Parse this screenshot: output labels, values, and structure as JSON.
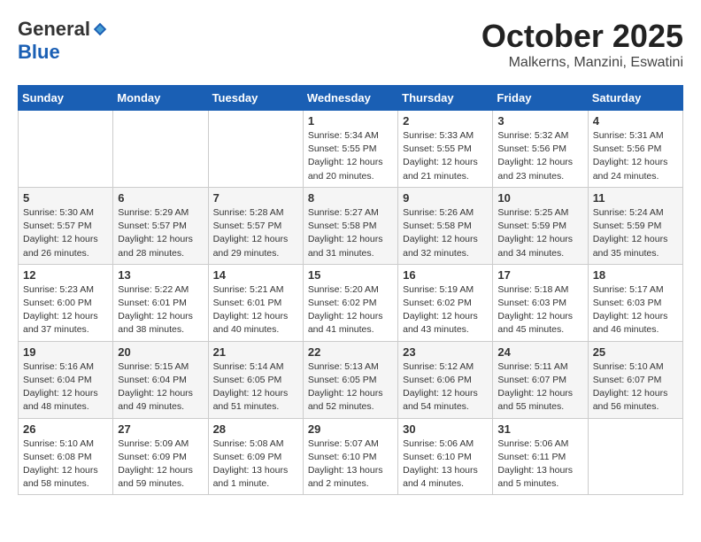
{
  "header": {
    "logo_general": "General",
    "logo_blue": "Blue",
    "month": "October 2025",
    "location": "Malkerns, Manzini, Eswatini"
  },
  "days_of_week": [
    "Sunday",
    "Monday",
    "Tuesday",
    "Wednesday",
    "Thursday",
    "Friday",
    "Saturday"
  ],
  "weeks": [
    [
      {
        "day": "",
        "info": ""
      },
      {
        "day": "",
        "info": ""
      },
      {
        "day": "",
        "info": ""
      },
      {
        "day": "1",
        "info": "Sunrise: 5:34 AM\nSunset: 5:55 PM\nDaylight: 12 hours and 20 minutes."
      },
      {
        "day": "2",
        "info": "Sunrise: 5:33 AM\nSunset: 5:55 PM\nDaylight: 12 hours and 21 minutes."
      },
      {
        "day": "3",
        "info": "Sunrise: 5:32 AM\nSunset: 5:56 PM\nDaylight: 12 hours and 23 minutes."
      },
      {
        "day": "4",
        "info": "Sunrise: 5:31 AM\nSunset: 5:56 PM\nDaylight: 12 hours and 24 minutes."
      }
    ],
    [
      {
        "day": "5",
        "info": "Sunrise: 5:30 AM\nSunset: 5:57 PM\nDaylight: 12 hours and 26 minutes."
      },
      {
        "day": "6",
        "info": "Sunrise: 5:29 AM\nSunset: 5:57 PM\nDaylight: 12 hours and 28 minutes."
      },
      {
        "day": "7",
        "info": "Sunrise: 5:28 AM\nSunset: 5:57 PM\nDaylight: 12 hours and 29 minutes."
      },
      {
        "day": "8",
        "info": "Sunrise: 5:27 AM\nSunset: 5:58 PM\nDaylight: 12 hours and 31 minutes."
      },
      {
        "day": "9",
        "info": "Sunrise: 5:26 AM\nSunset: 5:58 PM\nDaylight: 12 hours and 32 minutes."
      },
      {
        "day": "10",
        "info": "Sunrise: 5:25 AM\nSunset: 5:59 PM\nDaylight: 12 hours and 34 minutes."
      },
      {
        "day": "11",
        "info": "Sunrise: 5:24 AM\nSunset: 5:59 PM\nDaylight: 12 hours and 35 minutes."
      }
    ],
    [
      {
        "day": "12",
        "info": "Sunrise: 5:23 AM\nSunset: 6:00 PM\nDaylight: 12 hours and 37 minutes."
      },
      {
        "day": "13",
        "info": "Sunrise: 5:22 AM\nSunset: 6:01 PM\nDaylight: 12 hours and 38 minutes."
      },
      {
        "day": "14",
        "info": "Sunrise: 5:21 AM\nSunset: 6:01 PM\nDaylight: 12 hours and 40 minutes."
      },
      {
        "day": "15",
        "info": "Sunrise: 5:20 AM\nSunset: 6:02 PM\nDaylight: 12 hours and 41 minutes."
      },
      {
        "day": "16",
        "info": "Sunrise: 5:19 AM\nSunset: 6:02 PM\nDaylight: 12 hours and 43 minutes."
      },
      {
        "day": "17",
        "info": "Sunrise: 5:18 AM\nSunset: 6:03 PM\nDaylight: 12 hours and 45 minutes."
      },
      {
        "day": "18",
        "info": "Sunrise: 5:17 AM\nSunset: 6:03 PM\nDaylight: 12 hours and 46 minutes."
      }
    ],
    [
      {
        "day": "19",
        "info": "Sunrise: 5:16 AM\nSunset: 6:04 PM\nDaylight: 12 hours and 48 minutes."
      },
      {
        "day": "20",
        "info": "Sunrise: 5:15 AM\nSunset: 6:04 PM\nDaylight: 12 hours and 49 minutes."
      },
      {
        "day": "21",
        "info": "Sunrise: 5:14 AM\nSunset: 6:05 PM\nDaylight: 12 hours and 51 minutes."
      },
      {
        "day": "22",
        "info": "Sunrise: 5:13 AM\nSunset: 6:05 PM\nDaylight: 12 hours and 52 minutes."
      },
      {
        "day": "23",
        "info": "Sunrise: 5:12 AM\nSunset: 6:06 PM\nDaylight: 12 hours and 54 minutes."
      },
      {
        "day": "24",
        "info": "Sunrise: 5:11 AM\nSunset: 6:07 PM\nDaylight: 12 hours and 55 minutes."
      },
      {
        "day": "25",
        "info": "Sunrise: 5:10 AM\nSunset: 6:07 PM\nDaylight: 12 hours and 56 minutes."
      }
    ],
    [
      {
        "day": "26",
        "info": "Sunrise: 5:10 AM\nSunset: 6:08 PM\nDaylight: 12 hours and 58 minutes."
      },
      {
        "day": "27",
        "info": "Sunrise: 5:09 AM\nSunset: 6:09 PM\nDaylight: 12 hours and 59 minutes."
      },
      {
        "day": "28",
        "info": "Sunrise: 5:08 AM\nSunset: 6:09 PM\nDaylight: 13 hours and 1 minute."
      },
      {
        "day": "29",
        "info": "Sunrise: 5:07 AM\nSunset: 6:10 PM\nDaylight: 13 hours and 2 minutes."
      },
      {
        "day": "30",
        "info": "Sunrise: 5:06 AM\nSunset: 6:10 PM\nDaylight: 13 hours and 4 minutes."
      },
      {
        "day": "31",
        "info": "Sunrise: 5:06 AM\nSunset: 6:11 PM\nDaylight: 13 hours and 5 minutes."
      },
      {
        "day": "",
        "info": ""
      }
    ]
  ]
}
